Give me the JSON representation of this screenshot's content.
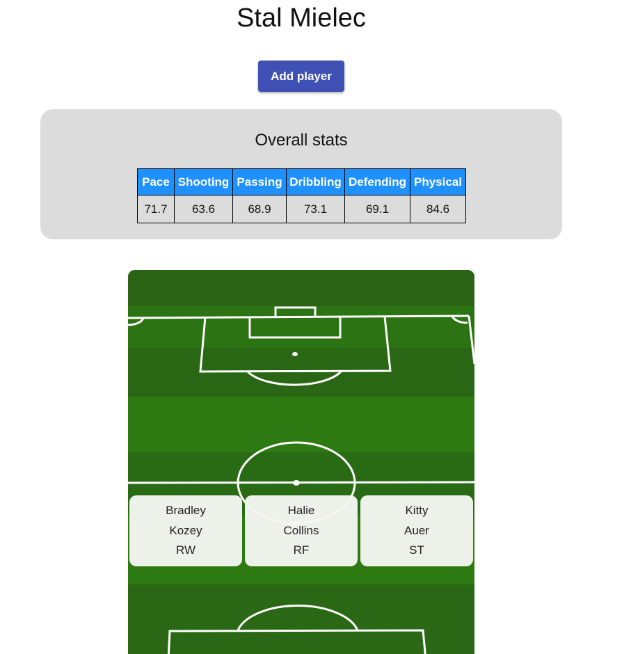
{
  "team": {
    "name": "Stal Mielec"
  },
  "actions": {
    "add_player_label": "Add player"
  },
  "stats": {
    "heading": "Overall stats",
    "headers": [
      "Pace",
      "Shooting",
      "Passing",
      "Dribbling",
      "Defending",
      "Physical"
    ],
    "values": [
      "71.7",
      "63.6",
      "68.9",
      "73.1",
      "69.1",
      "84.6"
    ],
    "header_color": "#1e90ff"
  },
  "pitch": {
    "grass_colors": [
      "#2f6b17",
      "#2a7a12"
    ],
    "line_color": "#ffffff"
  },
  "players": [
    {
      "first_name": "Bradley",
      "last_name": "Kozey",
      "position": "RW"
    },
    {
      "first_name": "Halie",
      "last_name": "Collins",
      "position": "RF"
    },
    {
      "first_name": "Kitty",
      "last_name": "Auer",
      "position": "ST"
    }
  ],
  "colors": {
    "primary_button": "#3f51b5",
    "panel_background": "#dcdcdc"
  }
}
